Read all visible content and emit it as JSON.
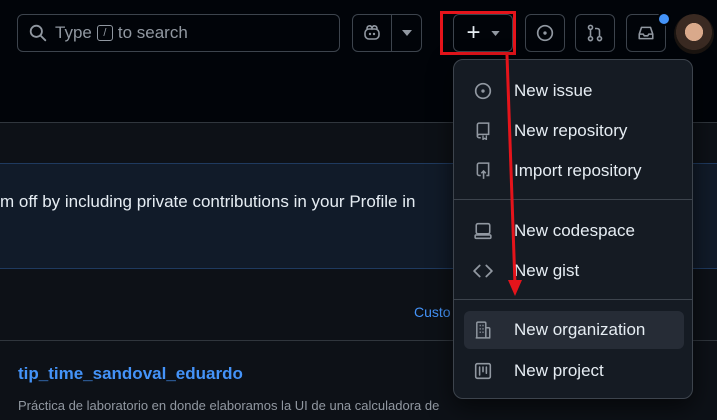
{
  "search": {
    "placeholder_before": "Type",
    "shortcut_key": "/",
    "placeholder_after": "to search"
  },
  "toolbar": {
    "create_label": "+"
  },
  "banner": {
    "text": "m off by including private contributions in your Profile in"
  },
  "main": {
    "customize_link": "Custo"
  },
  "repo": {
    "name": "tip_time_sandoval_eduardo",
    "description": "Práctica de laboratorio en donde elaboramos la UI de una calculadora de"
  },
  "create_menu": {
    "items": [
      {
        "label": "New issue",
        "icon": "issue-opened-icon"
      },
      {
        "label": "New repository",
        "icon": "repo-icon"
      },
      {
        "label": "Import repository",
        "icon": "repo-push-icon"
      },
      {
        "label": "New codespace",
        "icon": "codespaces-icon"
      },
      {
        "label": "New gist",
        "icon": "code-icon"
      },
      {
        "label": "New organization",
        "icon": "organization-icon"
      },
      {
        "label": "New project",
        "icon": "project-icon"
      }
    ]
  },
  "colors": {
    "accent": "#4493f8",
    "annotation": "#e5141b",
    "background": "#010409"
  }
}
